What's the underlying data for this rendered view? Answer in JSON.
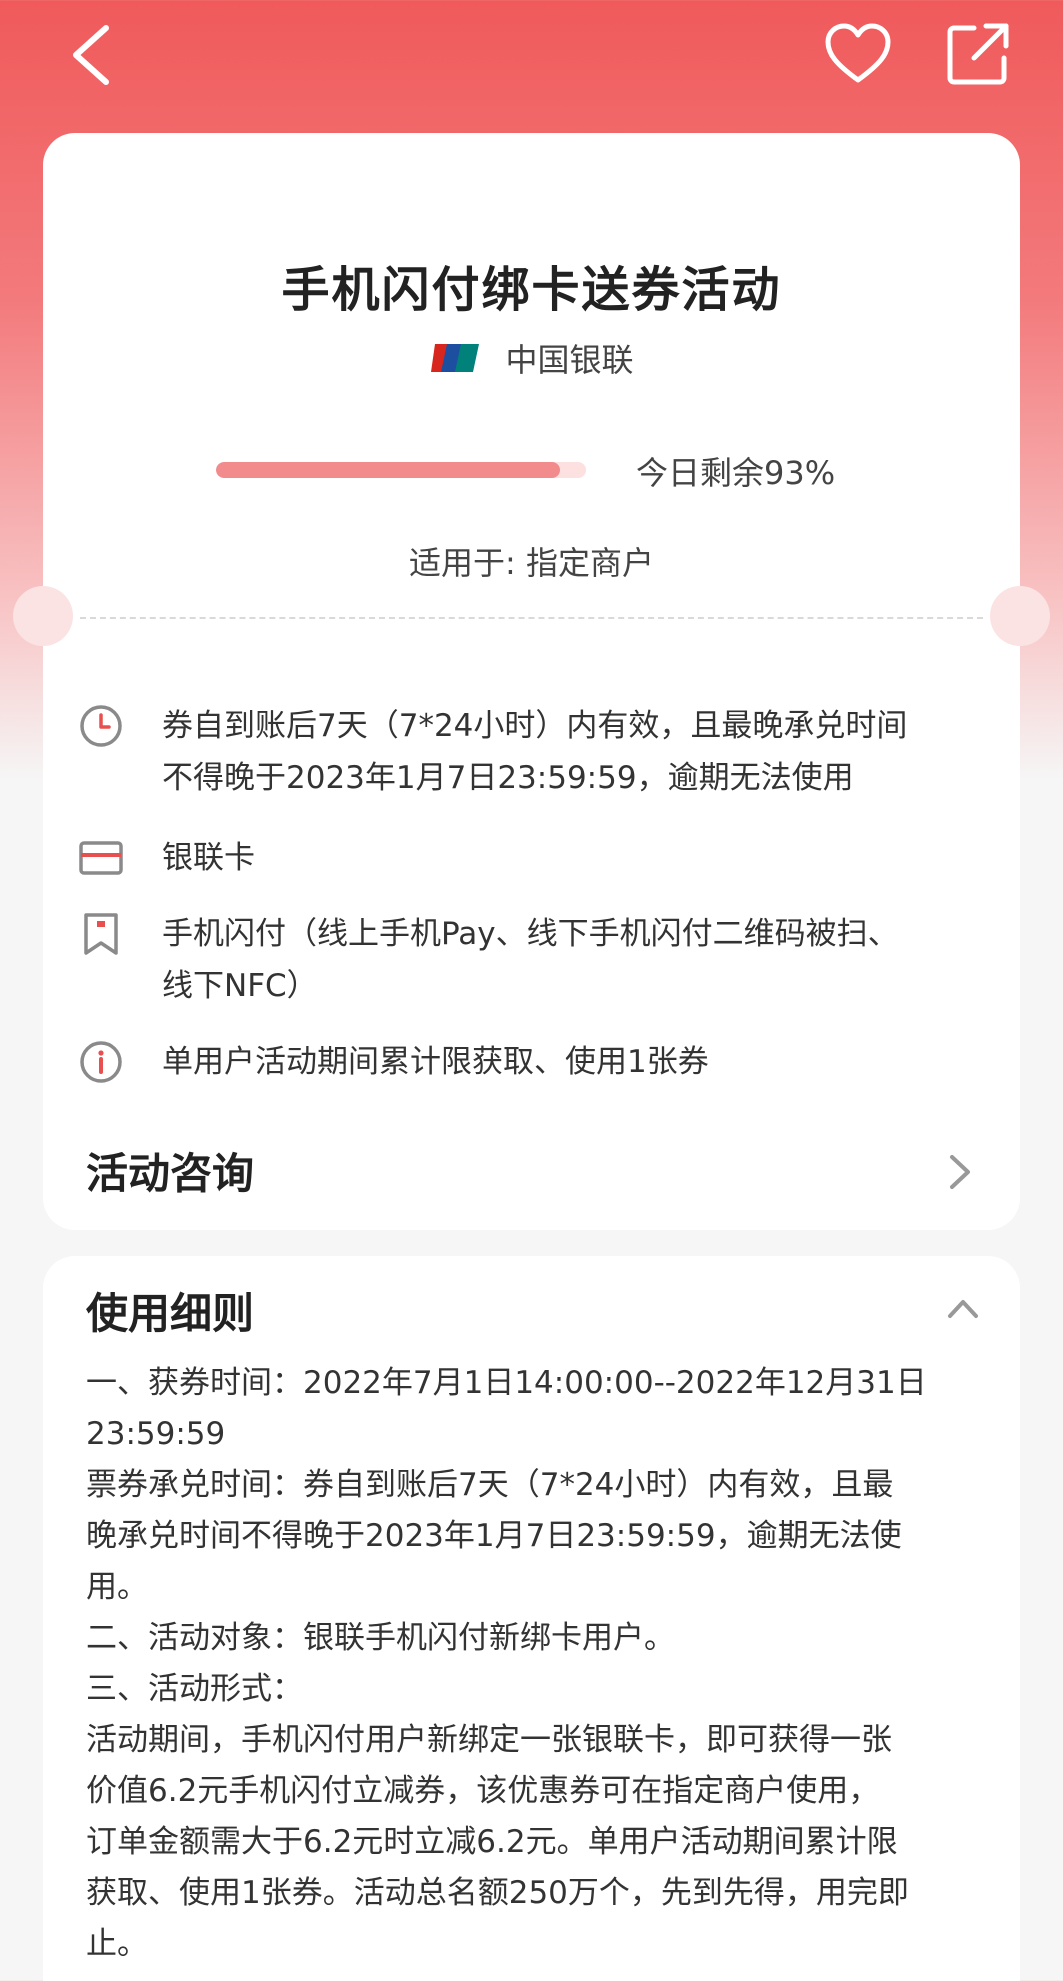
{
  "header": {
    "back_icon": "chevron-left-icon",
    "favorite_icon": "heart-icon",
    "share_icon": "share-icon"
  },
  "coupon": {
    "title": "手机闪付绑卡送券活动",
    "brand_logo_icon": "unionpay-logo",
    "brand_name": "中国银联",
    "remaining_percent": 93,
    "remaining_text": "今日剩余93%",
    "applies_to": "适用于: 指定商户"
  },
  "info": [
    {
      "icon": "clock-icon",
      "lines": [
        "券自到账后7天（7*24小时）内有效，且最晚承兑时间",
        "不得晚于2023年1月7日23:59:59，逾期无法使用"
      ]
    },
    {
      "icon": "card-icon",
      "lines": [
        "银联卡"
      ]
    },
    {
      "icon": "bookmark-icon",
      "lines": [
        "手机闪付（线上手机Pay、线下手机闪付二维码被扫、",
        "线下NFC）"
      ]
    },
    {
      "icon": "info-icon",
      "lines": [
        "单用户活动期间累计限获取、使用1张券"
      ]
    }
  ],
  "consult": {
    "label": "活动咨询",
    "icon": "chevron-right-icon"
  },
  "rules": {
    "title": "使用细则",
    "icon": "chevron-up-icon",
    "lines": [
      "一、获券时间：2022年7月1日14:00:00--2022年12月31日",
      "23:59:59",
      "票券承兑时间：券自到账后7天（7*24小时）内有效，且最",
      "晚承兑时间不得晚于2023年1月7日23:59:59，逾期无法使",
      "用。",
      "二、活动对象：银联手机闪付新绑卡用户。",
      "三、活动形式：",
      "活动期间，手机闪付用户新绑定一张银联卡，即可获得一张",
      "价值6.2元手机闪付立减券，该优惠券可在指定商户使用，",
      "订单金额需大于6.2元时立减6.2元。单用户活动期间累计限",
      "获取、使用1张券。活动总名额250万个，先到先得，用完即",
      "止。"
    ]
  },
  "colors": {
    "accent": "#f05a5b",
    "progress_fill": "#f28b8c",
    "progress_track": "#fde0e0",
    "icon_gray": "#8a8a8a"
  }
}
